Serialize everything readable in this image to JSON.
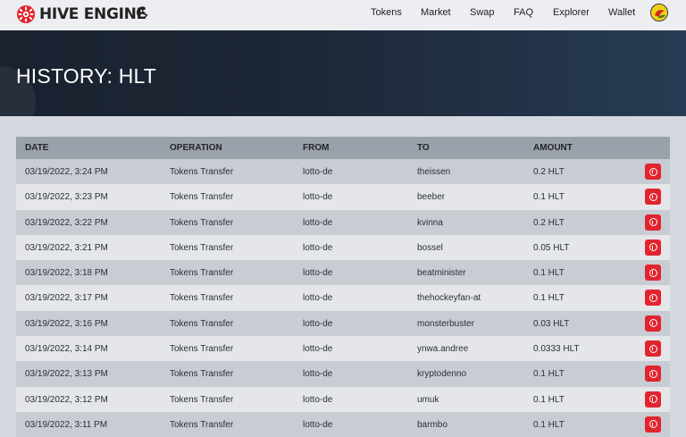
{
  "brand": {
    "name": "HIVE ENGINE",
    "logo_icon": "hive-engine-logo-icon",
    "accent": "#e2242e"
  },
  "nav": {
    "theme_toggle_icon": "moon-icon",
    "links": [
      "Tokens",
      "Market",
      "Swap",
      "FAQ",
      "Explorer",
      "Wallet"
    ],
    "avatar_icon": "user-avatar-icon"
  },
  "page": {
    "title": "HISTORY: HLT"
  },
  "table": {
    "columns": [
      "DATE",
      "OPERATION",
      "FROM",
      "TO",
      "AMOUNT"
    ],
    "row_action_icon": "info-icon",
    "rows": [
      {
        "date": "03/19/2022, 3:24 PM",
        "operation": "Tokens Transfer",
        "from": "lotto-de",
        "to": "theissen",
        "amount": "0.2 HLT"
      },
      {
        "date": "03/19/2022, 3:23 PM",
        "operation": "Tokens Transfer",
        "from": "lotto-de",
        "to": "beeber",
        "amount": "0.1 HLT"
      },
      {
        "date": "03/19/2022, 3:22 PM",
        "operation": "Tokens Transfer",
        "from": "lotto-de",
        "to": "kvinna",
        "amount": "0.2 HLT"
      },
      {
        "date": "03/19/2022, 3:21 PM",
        "operation": "Tokens Transfer",
        "from": "lotto-de",
        "to": "bossel",
        "amount": "0.05 HLT"
      },
      {
        "date": "03/19/2022, 3:18 PM",
        "operation": "Tokens Transfer",
        "from": "lotto-de",
        "to": "beatminister",
        "amount": "0.1 HLT"
      },
      {
        "date": "03/19/2022, 3:17 PM",
        "operation": "Tokens Transfer",
        "from": "lotto-de",
        "to": "thehockeyfan-at",
        "amount": "0.1 HLT"
      },
      {
        "date": "03/19/2022, 3:16 PM",
        "operation": "Tokens Transfer",
        "from": "lotto-de",
        "to": "monsterbuster",
        "amount": "0.03 HLT"
      },
      {
        "date": "03/19/2022, 3:14 PM",
        "operation": "Tokens Transfer",
        "from": "lotto-de",
        "to": "ynwa.andree",
        "amount": "0.0333 HLT"
      },
      {
        "date": "03/19/2022, 3:13 PM",
        "operation": "Tokens Transfer",
        "from": "lotto-de",
        "to": "kryptodenno",
        "amount": "0.1 HLT"
      },
      {
        "date": "03/19/2022, 3:12 PM",
        "operation": "Tokens Transfer",
        "from": "lotto-de",
        "to": "umuk",
        "amount": "0.1 HLT"
      },
      {
        "date": "03/19/2022, 3:11 PM",
        "operation": "Tokens Transfer",
        "from": "lotto-de",
        "to": "barmbo",
        "amount": "0.1 HLT"
      }
    ]
  }
}
